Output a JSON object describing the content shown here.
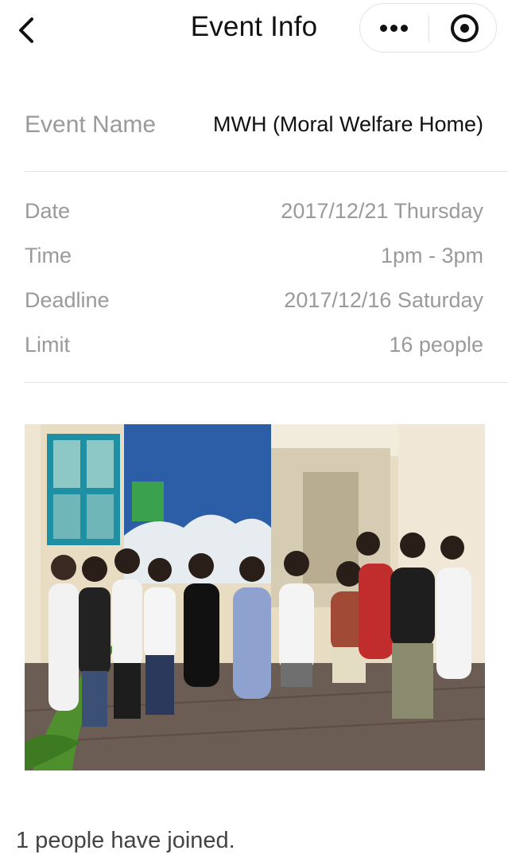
{
  "header": {
    "title": "Event Info",
    "back_icon": "chevron-left-icon",
    "more_icon": "more-dots-icon",
    "close_icon": "target-close-icon"
  },
  "event": {
    "name_label": "Event Name",
    "name_value": "MWH (Moral Welfare Home)",
    "details": [
      {
        "label": "Date",
        "value": "2017/12/21 Thursday"
      },
      {
        "label": "Time",
        "value": "1pm - 3pm"
      },
      {
        "label": "Deadline",
        "value": "2017/12/16 Saturday"
      },
      {
        "label": "Limit",
        "value": "16 people"
      }
    ]
  },
  "footer": {
    "joined_text": "1 people have joined."
  },
  "colors": {
    "label_gray": "#9a9a9a",
    "divider": "#e2e2e2",
    "text": "#111111"
  }
}
